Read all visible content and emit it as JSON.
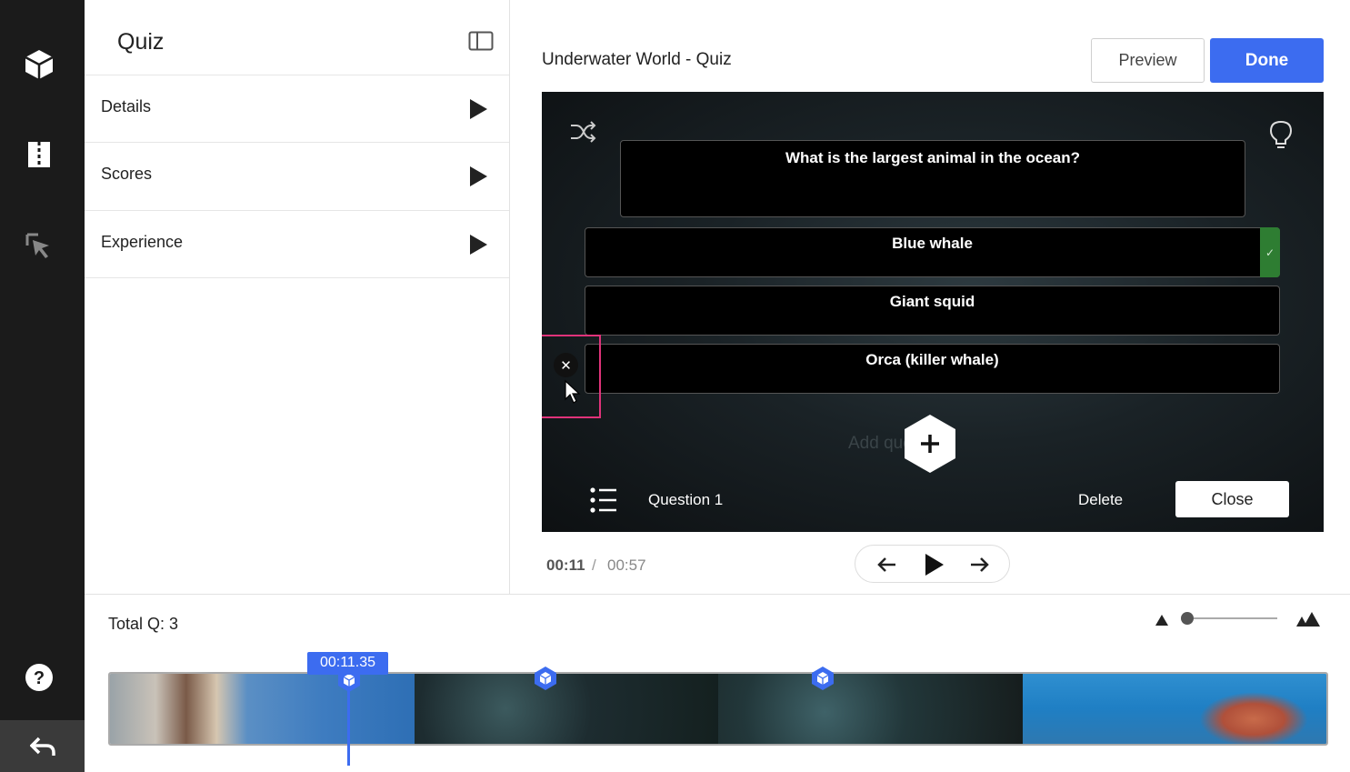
{
  "sidebar_rail": {
    "icons": [
      "cube-icon",
      "book-icon",
      "cursor-click-icon",
      "help-icon",
      "undo-icon"
    ],
    "help_label": "?"
  },
  "panel": {
    "title": "Quiz",
    "sections": [
      {
        "label": "Details"
      },
      {
        "label": "Scores"
      },
      {
        "label": "Experience"
      }
    ]
  },
  "header": {
    "video_title": "Underwater World - Quiz",
    "preview_label": "Preview",
    "done_label": "Done"
  },
  "quiz": {
    "question": "What is the largest animal in the ocean?",
    "answers": [
      {
        "text": "Blue whale",
        "correct": true
      },
      {
        "text": "Giant squid",
        "correct": false
      },
      {
        "text": "Orca (killer whale)",
        "correct": false
      }
    ],
    "correct_mark": "✓",
    "remove_mark": "✕",
    "add_question_ghost": "Add question",
    "question_label": "Question 1",
    "delete_label": "Delete",
    "close_label": "Close"
  },
  "player": {
    "current_time": "00:11",
    "separator": "/",
    "total_time": "00:57"
  },
  "timeline": {
    "total_q": "Total Q: 3",
    "playhead_time": "00:11.35",
    "zoom_level": 0.05,
    "accent": "#3c6cf0"
  },
  "colors": {
    "accent": "#3c6cf0",
    "rail": "#1b1b1b",
    "highlight": "#e0337a",
    "correct": "#2e7d32"
  }
}
